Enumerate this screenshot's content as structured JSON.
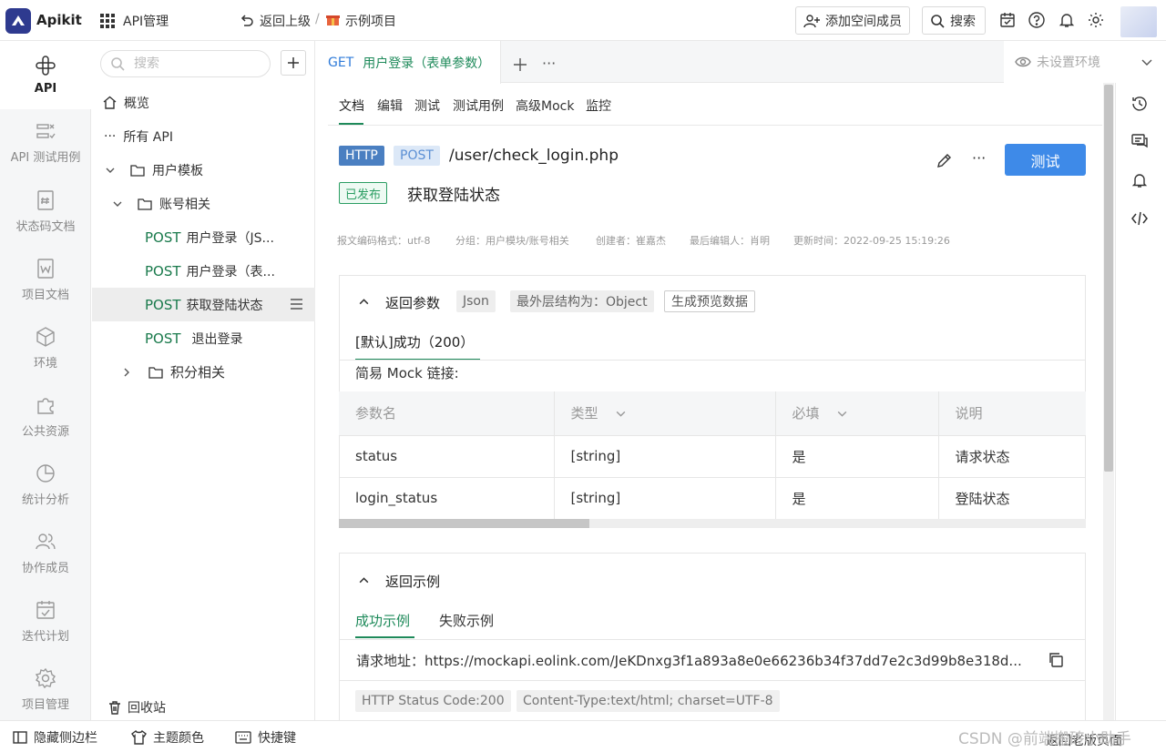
{
  "topbar": {
    "brand": "Apikit",
    "module": "API管理",
    "back": "返回上级",
    "sep": "/",
    "project": "示例项目",
    "add_member": "添加空间成员",
    "search": "搜索"
  },
  "rail": [
    {
      "label": "API",
      "icon": "api-icon"
    },
    {
      "label": "API 测试用例",
      "icon": "test-case-icon"
    },
    {
      "label": "状态码文档",
      "icon": "status-code-icon"
    },
    {
      "label": "项目文档",
      "icon": "doc-icon"
    },
    {
      "label": "环境",
      "icon": "env-icon"
    },
    {
      "label": "公共资源",
      "icon": "puzzle-icon"
    },
    {
      "label": "统计分析",
      "icon": "pie-icon"
    },
    {
      "label": "协作成员",
      "icon": "members-icon"
    },
    {
      "label": "迭代计划",
      "icon": "calendar-icon"
    },
    {
      "label": "项目管理",
      "icon": "settings-icon"
    }
  ],
  "tree": {
    "search_placeholder": "搜索",
    "overview": "概览",
    "all_api": "所有 API",
    "group_user": "用户模板",
    "group_account": "账号相关",
    "apis": [
      {
        "method": "POST",
        "name": "用户登录（JS..."
      },
      {
        "method": "POST",
        "name": "用户登录（表..."
      },
      {
        "method": "POST",
        "name": "获取登陆状态"
      },
      {
        "method": "POST",
        "name": "退出登录"
      }
    ],
    "group_points": "积分相关",
    "recycle": "回收站"
  },
  "tab": {
    "method": "GET",
    "title": "用户登录（表单参数）",
    "env": "未设置环境"
  },
  "subtabs": [
    "文档",
    "编辑",
    "测试",
    "测试用例",
    "高级Mock",
    "监控"
  ],
  "api": {
    "protocol": "HTTP",
    "method": "POST",
    "path": "/user/check_login.php",
    "status": "已发布",
    "name": "获取登陆状态",
    "test_button": "测试",
    "meta": {
      "encoding": "报文编码格式：utf-8",
      "group": "分组：用户模块/账号相关",
      "creator": "创建者：崔嘉杰",
      "editor": "最后编辑人：肖明",
      "updated": "更新时间：2022-09-25 15:19:26"
    }
  },
  "response": {
    "title": "返回参数",
    "format": "Json",
    "outer": "最外层结构为：Object",
    "preview": "生成预览数据",
    "default": "[默认]成功（200）",
    "mock": "简易 Mock 链接:",
    "columns": [
      "参数名",
      "类型",
      "必填",
      "说明"
    ],
    "rows": [
      {
        "name": "status",
        "type": "[string]",
        "required": "是",
        "desc": "请求状态"
      },
      {
        "name": "login_status",
        "type": "[string]",
        "required": "是",
        "desc": "登陆状态"
      }
    ]
  },
  "example": {
    "title": "返回示例",
    "tab_success": "成功示例",
    "tab_fail": "失败示例",
    "url": "请求地址：https://mockapi.eolink.com/JeKDnxg3f1a893a8e0e66236b34f37dd7e2c3d99b8e318d...",
    "status_code": "HTTP Status Code:200",
    "content_type": "Content-Type:text/html; charset=UTF-8"
  },
  "bottombar": {
    "hide_sidebar": "隐藏侧边栏",
    "theme": "主题颜色",
    "shortcuts": "快捷键",
    "watermark": "CSDN @前端搬砖小助手",
    "old_version": "返回老版页面"
  },
  "colors": {
    "accent": "#3e8ae8",
    "green": "#1e8a5a",
    "brand": "#2e3a8f"
  }
}
